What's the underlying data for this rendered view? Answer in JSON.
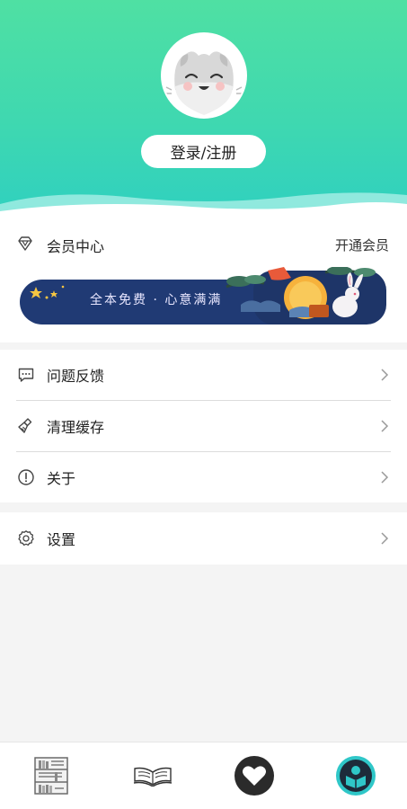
{
  "header": {
    "login_label": "登录/注册"
  },
  "vip": {
    "title": "会员中心",
    "action": "开通会员",
    "banner_text": "全本免费 · 心意满满"
  },
  "menu": {
    "items": [
      {
        "label": "问题反馈",
        "icon": "message-icon"
      },
      {
        "label": "清理缓存",
        "icon": "broom-icon"
      },
      {
        "label": "关于",
        "icon": "info-icon"
      }
    ]
  },
  "settings": {
    "label": "设置",
    "icon": "gear-icon"
  },
  "tabbar": {
    "tabs": [
      {
        "name": "bookshelf",
        "icon": "bookshelf-icon"
      },
      {
        "name": "reading",
        "icon": "open-book-icon"
      },
      {
        "name": "favorites",
        "icon": "heart-icon"
      },
      {
        "name": "profile",
        "icon": "profile-icon",
        "active": true
      }
    ]
  },
  "colors": {
    "header_top": "#4fe0a3",
    "header_bottom": "#2fd0c0",
    "banner_bg": "#203a74",
    "active_tab": "#2fc7c8"
  }
}
